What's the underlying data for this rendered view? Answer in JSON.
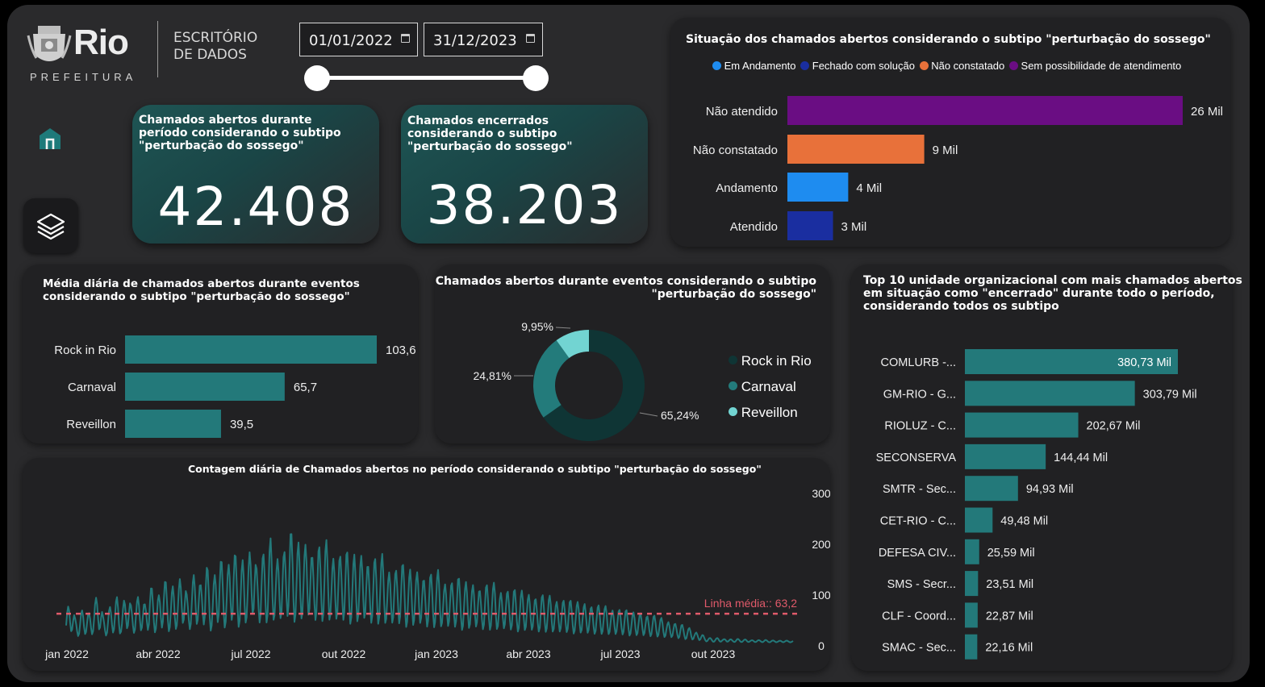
{
  "header": {
    "logo_word": "Rio",
    "logo_sub": "PREFEITURA",
    "office_line1": "ESCRITÓRIO",
    "office_line2": "DE DADOS"
  },
  "date_filter": {
    "start": "01/01/2022",
    "end": "31/12/2023",
    "slider_start_fraction": 0,
    "slider_end_fraction": 1
  },
  "nav": {
    "home_icon": "home-icon",
    "layers_icon": "layers-icon"
  },
  "kpi": [
    {
      "title": "Chamados abertos durante período considerando o subtipo \"perturbação do sossego\"",
      "value": "42.408"
    },
    {
      "title": "Chamados encerrados considerando o subtipo \"perturbação do sossego\"",
      "value": "38.203"
    }
  ],
  "situation_chart": {
    "title": "Situação dos chamados abertos considerando o subtipo \"perturbação do sossego\"",
    "legend": [
      {
        "name": "Em Andamento",
        "color": "#1e8cf0"
      },
      {
        "name": "Fechado com solução",
        "color": "#1a2ea0"
      },
      {
        "name": "Não constatado",
        "color": "#e8713a"
      },
      {
        "name": "Sem possibilidade de atendimento",
        "color": "#6a0d83"
      }
    ],
    "labels": [
      "26 Mil",
      "9 Mil",
      "4 Mil",
      "3 Mil"
    ]
  },
  "events_avg": {
    "title": "Média diária de chamados abertos durante eventos considerando o subtipo \"perturbação do sossego\"",
    "labels": [
      "103,6",
      "65,7",
      "39,5"
    ]
  },
  "events_donut": {
    "title_line1": "Chamados abertos durante eventos considerando o subtipo",
    "title_line2": "\"perturbação do sossego\"",
    "legend": [
      {
        "name": "Rock in Rio",
        "color": "#0f3535"
      },
      {
        "name": "Carnaval",
        "color": "#237b7b"
      },
      {
        "name": "Reveillon",
        "color": "#72d4d2"
      }
    ],
    "labels": [
      "65,24%",
      "24,81%",
      "9,95%"
    ]
  },
  "daily_chart": {
    "title": "Contagem diária de Chamados abertos no período considerando o subtipo \"perturbação do sossego\"",
    "avg_label": "Linha média:: 63,2"
  },
  "top10": {
    "title_line1": "Top 10 unidade organizacional com mais chamados abertos",
    "title_line2": "em situação como \"encerrado\" durante todo o período,",
    "title_line3": "considerando todos os subtipo",
    "labels": [
      "380,73 Mil",
      "303,79 Mil",
      "202,67 Mil",
      "144,44 Mil",
      "94,93 Mil",
      "49,48 Mil",
      "25,59 Mil",
      "23,51 Mil",
      "22,87 Mil",
      "22,16 Mil"
    ]
  },
  "chart_data": [
    {
      "type": "bar",
      "title": "Situação dos chamados abertos considerando o subtipo \"perturbação do sossego\"",
      "orientation": "horizontal",
      "categories": [
        "Não atendido",
        "Não constatado",
        "Andamento",
        "Atendido"
      ],
      "values": [
        26000,
        9000,
        4000,
        3000
      ],
      "colors": [
        "#6a0d83",
        "#e8713a",
        "#1e8cf0",
        "#1a2ea0"
      ],
      "legend_position": "top"
    },
    {
      "type": "bar",
      "title": "Média diária de chamados abertos durante eventos considerando o subtipo \"perturbação do sossego\"",
      "orientation": "horizontal",
      "categories": [
        "Rock in Rio",
        "Carnaval",
        "Reveillon"
      ],
      "values": [
        103.6,
        65.7,
        39.5
      ]
    },
    {
      "type": "pie",
      "title": "Chamados abertos durante eventos considerando o subtipo \"perturbação do sossego\"",
      "donut": true,
      "categories": [
        "Rock in Rio",
        "Carnaval",
        "Reveillon"
      ],
      "values": [
        65.24,
        24.81,
        9.95
      ],
      "colors": [
        "#0f3535",
        "#237b7b",
        "#72d4d2"
      ],
      "legend_position": "right"
    },
    {
      "type": "line",
      "title": "Contagem diária de Chamados abertos no período considerando o subtipo \"perturbação do sossego\"",
      "x_range": [
        "2022-01-01",
        "2023-12-31"
      ],
      "x_ticks": [
        "jan 2022",
        "abr 2022",
        "jul 2022",
        "out 2022",
        "jan 2023",
        "abr 2023",
        "jul 2023",
        "out 2023"
      ],
      "y_ticks": [
        0,
        100,
        200,
        300
      ],
      "ylim": [
        0,
        300
      ],
      "y_axis_side": "right",
      "reference_line": {
        "label": "Linha média",
        "value": 63.2
      },
      "series": [
        {
          "values": [
            55,
            95,
            45,
            60,
            70,
            58,
            75,
            110,
            48,
            65,
            80,
            92,
            60,
            118,
            70,
            85,
            100,
            74,
            125,
            82,
            96,
            140,
            90,
            115,
            105,
            160,
            88,
            125,
            150,
            110,
            175,
            95,
            140,
            185,
            120,
            160,
            200,
            125,
            170,
            150,
            230,
            135,
            185,
            160,
            215,
            150,
            195,
            178,
            245,
            165,
            205,
            180,
            222,
            160,
            200,
            172,
            210,
            155,
            190,
            168,
            195,
            150,
            180,
            160,
            198,
            142,
            175,
            150,
            182,
            130,
            160,
            140,
            170,
            124,
            150,
            132,
            158,
            116,
            142,
            122,
            150,
            108,
            134,
            115,
            140,
            100,
            126,
            108,
            130,
            96,
            120,
            102,
            124,
            92,
            116,
            98,
            112,
            88,
            108,
            92,
            104,
            82,
            98,
            86,
            96,
            78,
            90,
            82,
            88,
            72,
            84,
            76,
            80,
            68,
            76,
            70,
            74,
            62,
            70,
            64,
            68,
            56,
            62,
            58,
            60,
            50,
            56,
            48,
            50,
            40,
            45,
            35,
            38,
            28,
            30,
            20,
            22,
            12,
            10,
            8,
            10,
            7,
            9,
            6,
            8,
            6,
            7,
            5,
            6,
            5,
            6,
            4,
            5,
            4,
            5,
            4,
            4
          ]
        }
      ]
    },
    {
      "type": "bar",
      "title": "Top 10 unidade organizacional com mais chamados abertos em situação como \"encerrado\" durante todo o período, considerando todos os subtipo",
      "orientation": "horizontal",
      "categories": [
        "COMLURB -...",
        "GM-RIO - G...",
        "RIOLUZ - C...",
        "SECONSERVA",
        "SMTR - Sec...",
        "CET-RIO - C...",
        "DEFESA CIV...",
        "SMS - Secr...",
        "CLF - Coord...",
        "SMAC - Sec..."
      ],
      "values": [
        380730,
        303790,
        202670,
        144440,
        94930,
        49480,
        25590,
        23510,
        22870,
        22160
      ]
    }
  ]
}
